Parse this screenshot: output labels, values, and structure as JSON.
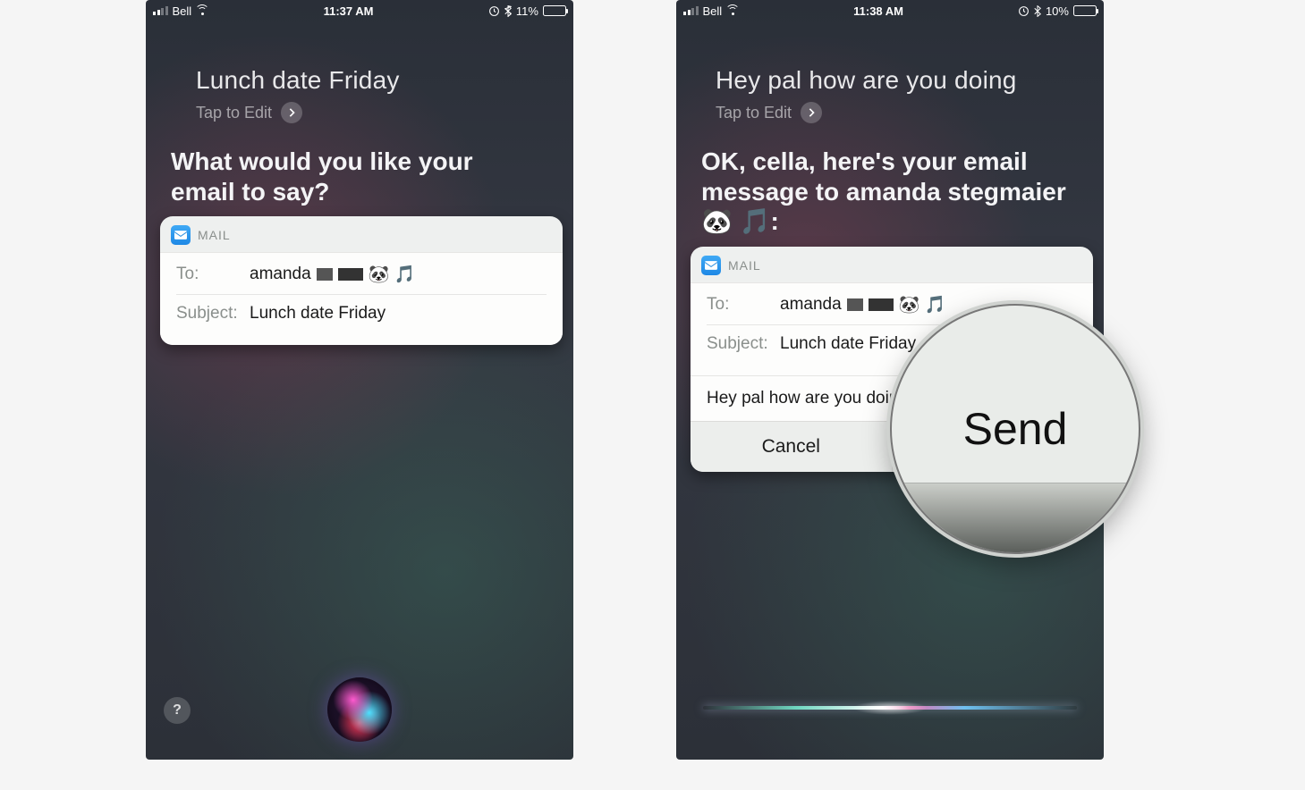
{
  "screens": {
    "left": {
      "status": {
        "carrier": "Bell",
        "time": "11:37 AM",
        "battery_pct": "11%"
      },
      "utterance": "Lunch date Friday",
      "tap_to_edit": "Tap to Edit",
      "prompt": "What would you like your email to say?",
      "mail": {
        "app_label": "MAIL",
        "to_label": "To:",
        "to_name": "amanda",
        "to_emoji": "🐼 🎵",
        "subject_label": "Subject:",
        "subject_value": "Lunch date Friday"
      }
    },
    "right": {
      "status": {
        "carrier": "Bell",
        "time": "11:38 AM",
        "battery_pct": "10%"
      },
      "utterance": "Hey pal how are you doing",
      "tap_to_edit": "Tap to Edit",
      "prompt": "OK, cella, here's your email message to amanda stegmaier 🐼 🎵:",
      "mail": {
        "app_label": "MAIL",
        "to_label": "To:",
        "to_name": "amanda",
        "to_emoji": "🐼 🎵",
        "subject_label": "Subject:",
        "subject_value": "Lunch date Friday",
        "body": "Hey pal how are you doing",
        "cancel": "Cancel",
        "send": "Send"
      }
    }
  },
  "magnifier": {
    "label": "Send"
  },
  "icons": {
    "help": "?"
  }
}
